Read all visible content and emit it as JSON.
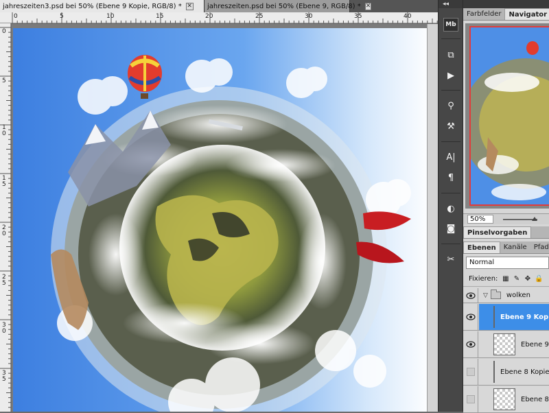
{
  "document_tabs": [
    {
      "title": "jahreszeiten3.psd bei 50% (Ebene 9 Kopie, RGB/8) *",
      "active": true
    },
    {
      "title": "jahreszeiten.psd bei 50% (Ebene 9, RGB/8) *",
      "active": false
    }
  ],
  "tab_close_glyph": "✕",
  "ruler": {
    "h_labels": [
      "0",
      "5",
      "10",
      "15",
      "20",
      "25",
      "30",
      "35",
      "40"
    ],
    "v_labels": [
      "0",
      "5",
      "1\n0",
      "1\n5",
      "2\n0",
      "2\n5",
      "3\n0",
      "3\n5"
    ]
  },
  "tools_top_glyph": "◂◂",
  "tools": [
    {
      "name": "mini-bridge-icon",
      "glyph": "Mb"
    },
    {
      "name": "history-icon",
      "glyph": "⧉"
    },
    {
      "name": "actions-icon",
      "glyph": "▶"
    },
    {
      "name": "clone-source-icon",
      "glyph": "⚲"
    },
    {
      "name": "tool-presets-icon",
      "glyph": "⚒"
    },
    {
      "name": "character-icon",
      "glyph": "A|"
    },
    {
      "name": "paragraph-icon",
      "glyph": "¶"
    },
    {
      "name": "adjustments-icon",
      "glyph": "◐"
    },
    {
      "name": "masks-icon",
      "glyph": "◙"
    },
    {
      "name": "styles-icon",
      "glyph": "✂"
    }
  ],
  "panels": {
    "top_tabs": [
      {
        "label": "Farbfelder",
        "active": false
      },
      {
        "label": "Navigator",
        "active": true
      }
    ],
    "navigator_zoom": "50%",
    "brush_tabs": [
      {
        "label": "Pinselvorgaben",
        "active": true
      }
    ],
    "layer_tabs": [
      {
        "label": "Ebenen",
        "active": true
      },
      {
        "label": "Kanäle",
        "active": false
      },
      {
        "label": "Pfade",
        "active": false
      }
    ],
    "blend_mode": "Normal",
    "lock_label": "Fixieren:",
    "lock_icons": [
      {
        "name": "lock-transparency-icon",
        "glyph": "▦"
      },
      {
        "name": "lock-brush-icon",
        "glyph": "✎"
      },
      {
        "name": "lock-move-icon",
        "glyph": "✥"
      },
      {
        "name": "lock-all-icon",
        "glyph": "🔒"
      }
    ],
    "layers": [
      {
        "type": "group",
        "name": "wolken",
        "visible": true,
        "selected": false
      },
      {
        "type": "layer",
        "name": "Ebene 9 Kopie",
        "visible": true,
        "selected": true
      },
      {
        "type": "layer",
        "name": "Ebene 9",
        "visible": true,
        "selected": false
      },
      {
        "type": "layer",
        "name": "Ebene 8 Kopie",
        "visible": false,
        "selected": false
      },
      {
        "type": "layer",
        "name": "Ebene 8",
        "visible": false,
        "selected": false
      }
    ]
  }
}
